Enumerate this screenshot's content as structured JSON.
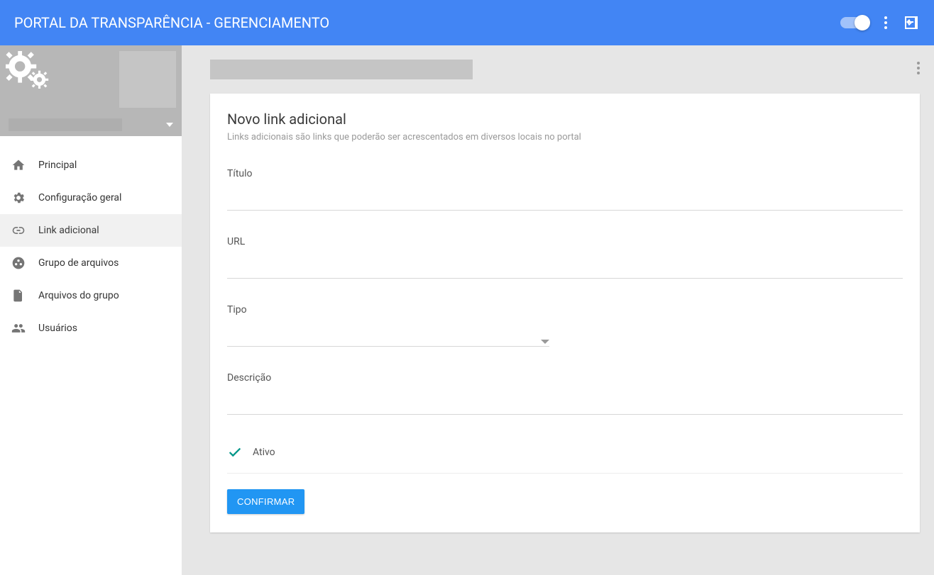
{
  "appbar": {
    "title": "PORTAL DA TRANSPARÊNCIA - GERENCIAMENTO"
  },
  "sidebar": {
    "items": [
      {
        "label": "Principal"
      },
      {
        "label": "Configuração geral"
      },
      {
        "label": "Link adicional"
      },
      {
        "label": "Grupo de arquivos"
      },
      {
        "label": "Arquivos do grupo"
      },
      {
        "label": "Usuários"
      }
    ]
  },
  "main": {
    "card": {
      "title": "Novo link adicional",
      "subtitle": "Links adicionais são links que poderão ser acrescentados em diversos locais no portal",
      "fields": {
        "titulo": {
          "label": "Título",
          "value": ""
        },
        "url": {
          "label": "URL",
          "value": ""
        },
        "tipo": {
          "label": "Tipo",
          "value": ""
        },
        "descricao": {
          "label": "Descrição",
          "value": ""
        },
        "ativo": {
          "label": "Ativo",
          "checked": true
        }
      },
      "submit": "CONFIRMAR"
    }
  },
  "colors": {
    "primary": "#4285f4",
    "accent": "#009688",
    "button": "#2196f3"
  }
}
